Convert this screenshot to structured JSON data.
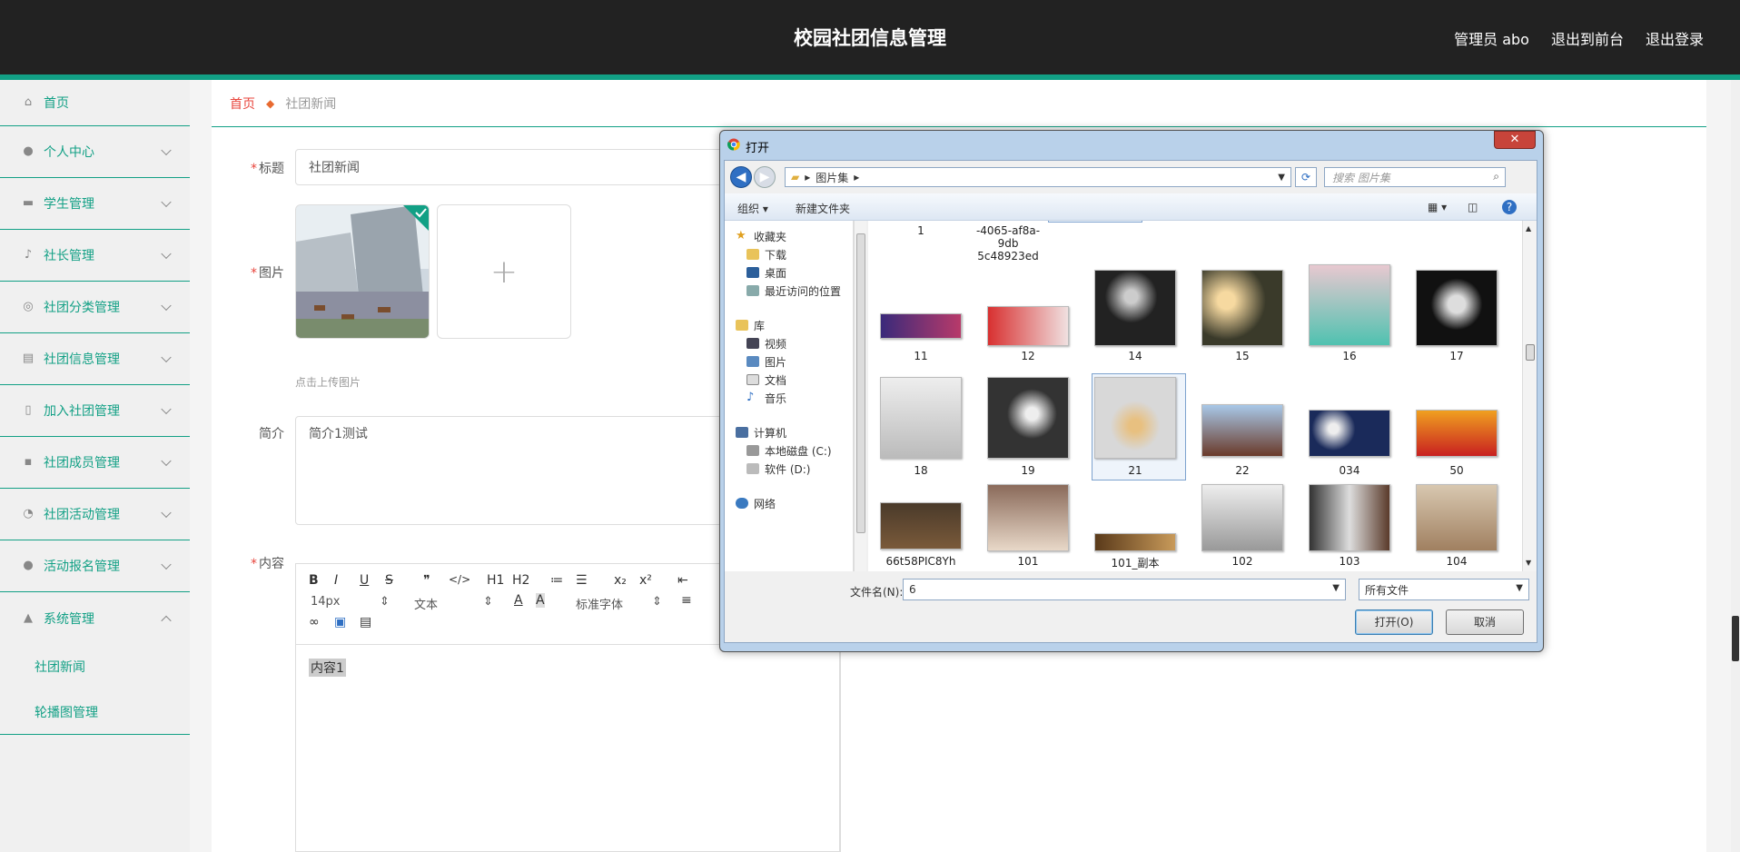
{
  "header": {
    "title": "校园社团信息管理",
    "user": "管理员 abo",
    "to_front": "退出到前台",
    "logout": "退出登录"
  },
  "sidebar": {
    "items": [
      {
        "label": "首页",
        "icon": "home-icon"
      },
      {
        "label": "个人中心",
        "icon": "user-icon"
      },
      {
        "label": "学生管理",
        "icon": "briefcase-icon"
      },
      {
        "label": "社长管理",
        "icon": "mic-icon"
      },
      {
        "label": "社团分类管理",
        "icon": "target-icon"
      },
      {
        "label": "社团信息管理",
        "icon": "clipboard-icon"
      },
      {
        "label": "加入社团管理",
        "icon": "phone-icon"
      },
      {
        "label": "社团成员管理",
        "icon": "chat-icon"
      },
      {
        "label": "社团活动管理",
        "icon": "gauge-icon"
      },
      {
        "label": "活动报名管理",
        "icon": "bulb-icon"
      },
      {
        "label": "系统管理",
        "icon": "chart-icon"
      }
    ],
    "sub_items": [
      "社团新闻",
      "轮播图管理"
    ]
  },
  "breadcrumb": {
    "home": "首页",
    "current": "社团新闻"
  },
  "form": {
    "title_label": "标题",
    "title_value": "社团新闻",
    "image_label": "图片",
    "upload_hint": "点击上传图片",
    "intro_label": "简介",
    "intro_value": "简介1测试",
    "content_label": "内容",
    "content_value": "内容1",
    "editor": {
      "font_size": "14px",
      "paragraph": "文本",
      "font_family": "标准字体",
      "buttons": [
        "B",
        "I",
        "U",
        "S",
        "❞",
        "</>",
        "H1",
        "H2",
        "≔",
        "☰",
        "x₂",
        "x²"
      ]
    }
  },
  "dialog": {
    "title": "打开",
    "close": "✕",
    "address": [
      "图片集"
    ],
    "search_placeholder": "搜索 图片集",
    "organize": "组织 ▾",
    "new_folder": "新建文件夹",
    "nav": {
      "favorites": "收藏夹",
      "downloads": "下载",
      "desktop": "桌面",
      "recent": "最近访问的位置",
      "libraries": "库",
      "videos": "视频",
      "pictures": "图片",
      "documents": "文档",
      "music": "音乐",
      "computer": "计算机",
      "disk_c": "本地磁盘 (C:)",
      "disk_d": "软件 (D:)",
      "network": "网络"
    },
    "files_top": [
      "1",
      "-4065-af8a-9db\n5c48923ed"
    ],
    "files_row1": [
      "11",
      "12",
      "14",
      "15",
      "16",
      "17"
    ],
    "files_row2": [
      "18",
      "19",
      "21",
      "22",
      "034",
      "50"
    ],
    "files_row3": [
      "66t58PIC8Yh",
      "101",
      "101_副本",
      "102",
      "103",
      "104"
    ],
    "filename_label": "文件名(N):",
    "filename_value": "6",
    "filetype": "所有文件",
    "open_button": "打开(O)",
    "cancel_button": "取消"
  }
}
